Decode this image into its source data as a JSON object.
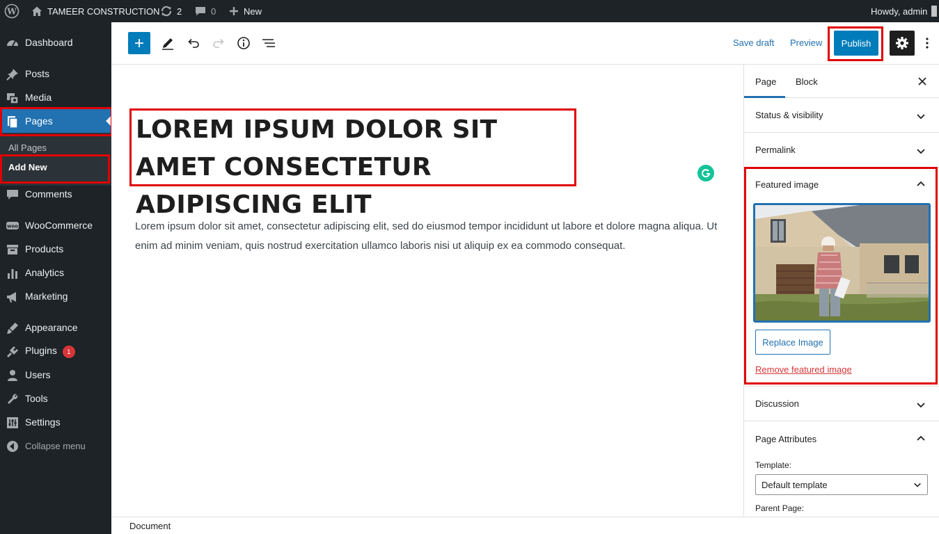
{
  "admin_bar": {
    "site_name": "TAMEER CONSTRUCTION",
    "updates_count": "2",
    "comments_count": "0",
    "new_label": "New",
    "greeting": "Howdy, admin"
  },
  "sidebar": {
    "items": [
      {
        "label": "Dashboard",
        "icon": "dashboard-icon"
      },
      {
        "label": "Posts",
        "icon": "pin-icon"
      },
      {
        "label": "Media",
        "icon": "media-icon"
      },
      {
        "label": "Pages",
        "icon": "pages-icon"
      },
      {
        "label": "Comments",
        "icon": "comment-icon"
      },
      {
        "label": "WooCommerce",
        "icon": "woo-icon"
      },
      {
        "label": "Products",
        "icon": "archive-icon"
      },
      {
        "label": "Analytics",
        "icon": "chart-icon"
      },
      {
        "label": "Marketing",
        "icon": "megaphone-icon"
      },
      {
        "label": "Appearance",
        "icon": "brush-icon"
      },
      {
        "label": "Plugins",
        "icon": "plugin-icon",
        "badge": "1"
      },
      {
        "label": "Users",
        "icon": "user-icon"
      },
      {
        "label": "Tools",
        "icon": "wrench-icon"
      },
      {
        "label": "Settings",
        "icon": "sliders-icon"
      },
      {
        "label": "Collapse menu",
        "icon": "collapse-icon"
      }
    ],
    "submenu": [
      "All Pages",
      "Add New"
    ],
    "current": "Pages"
  },
  "toolbar": {
    "save_draft": "Save draft",
    "preview": "Preview",
    "publish": "Publish"
  },
  "editor": {
    "title": "LOREM IPSUM DOLOR SIT AMET CONSECTETUR ADIPISCING ELIT",
    "paragraph": "Lorem ipsum dolor sit amet, consectetur adipiscing elit, sed do eiusmod tempor incididunt ut labore et dolore magna aliqua. Ut enim ad minim veniam, quis nostrud exercitation ullamco laboris nisi ut aliquip ex ea commodo consequat."
  },
  "settings_sidebar": {
    "tabs": [
      "Page",
      "Block"
    ],
    "active_tab": "Page",
    "panels": {
      "status": "Status & visibility",
      "permalink": "Permalink",
      "featured_image": "Featured image",
      "replace_image": "Replace Image",
      "remove_image": "Remove featured image",
      "discussion": "Discussion",
      "page_attributes": "Page Attributes",
      "template_label": "Template:",
      "template_value": "Default template",
      "parent_label": "Parent Page:"
    }
  },
  "footer": {
    "breadcrumb": "Document"
  },
  "colors": {
    "admin_bg": "#1d2327",
    "accent": "#2271b1",
    "publish_bg": "#007cba",
    "highlight_border": "#e00000",
    "danger": "#d63638"
  }
}
